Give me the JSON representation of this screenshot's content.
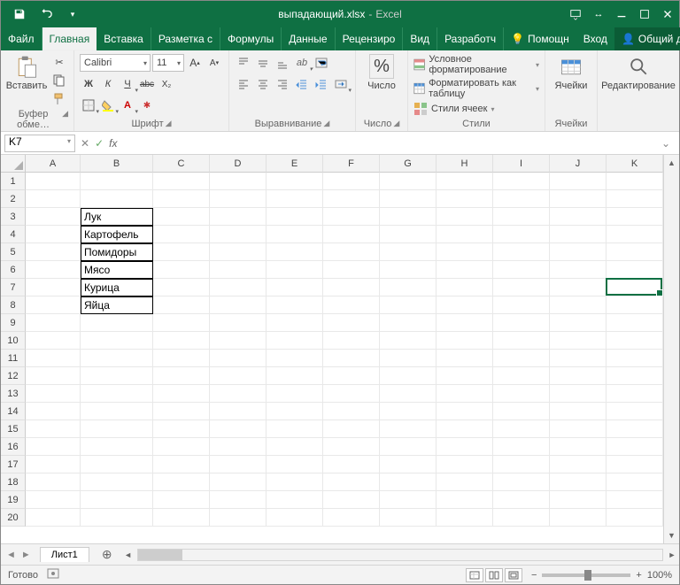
{
  "title": {
    "filename": "выпадающий.xlsx",
    "sep": "-",
    "app": "Excel"
  },
  "tabs": {
    "file": "Файл",
    "home": "Главная",
    "insert": "Вставка",
    "layout": "Разметка с",
    "formulas": "Формулы",
    "data": "Данные",
    "review": "Рецензиро",
    "view": "Вид",
    "developer": "Разработч",
    "tell": "Помощн",
    "signin": "Вход",
    "share": "Общий доступ"
  },
  "ribbon": {
    "clipboard": {
      "paste": "Вставить",
      "label": "Буфер обме…"
    },
    "font": {
      "name": "Calibri",
      "size": "11",
      "label": "Шрифт",
      "bold": "Ж",
      "italic": "К",
      "under": "Ч",
      "strike": "abc"
    },
    "align": {
      "label": "Выравнивание"
    },
    "number": {
      "big": "%",
      "biglbl": "Число",
      "label": "Число"
    },
    "styles": {
      "cond": "Условное форматирование",
      "table": "Форматировать как таблицу",
      "cell": "Стили ячеек",
      "label": "Стили"
    },
    "cells": {
      "big": "Ячейки",
      "label": "Ячейки"
    },
    "edit": {
      "big": "Редактирование",
      "label": ""
    }
  },
  "fbar": {
    "name": "K7",
    "fx": "fx",
    "value": ""
  },
  "cols": [
    "A",
    "B",
    "C",
    "D",
    "E",
    "F",
    "G",
    "H",
    "I",
    "J",
    "K"
  ],
  "rows": [
    "1",
    "2",
    "3",
    "4",
    "5",
    "6",
    "7",
    "8",
    "9",
    "10",
    "11",
    "12",
    "13",
    "14",
    "15",
    "16",
    "17",
    "18",
    "19",
    "20"
  ],
  "cells": {
    "B3": "Лук",
    "B4": "Картофель",
    "B5": "Помидоры",
    "B6": "Мясо",
    "B7": "Курица",
    "B8": "Яйца"
  },
  "sheet": {
    "name": "Лист1",
    "add": "⊕"
  },
  "status": {
    "ready": "Готово",
    "zoom": "100%"
  }
}
